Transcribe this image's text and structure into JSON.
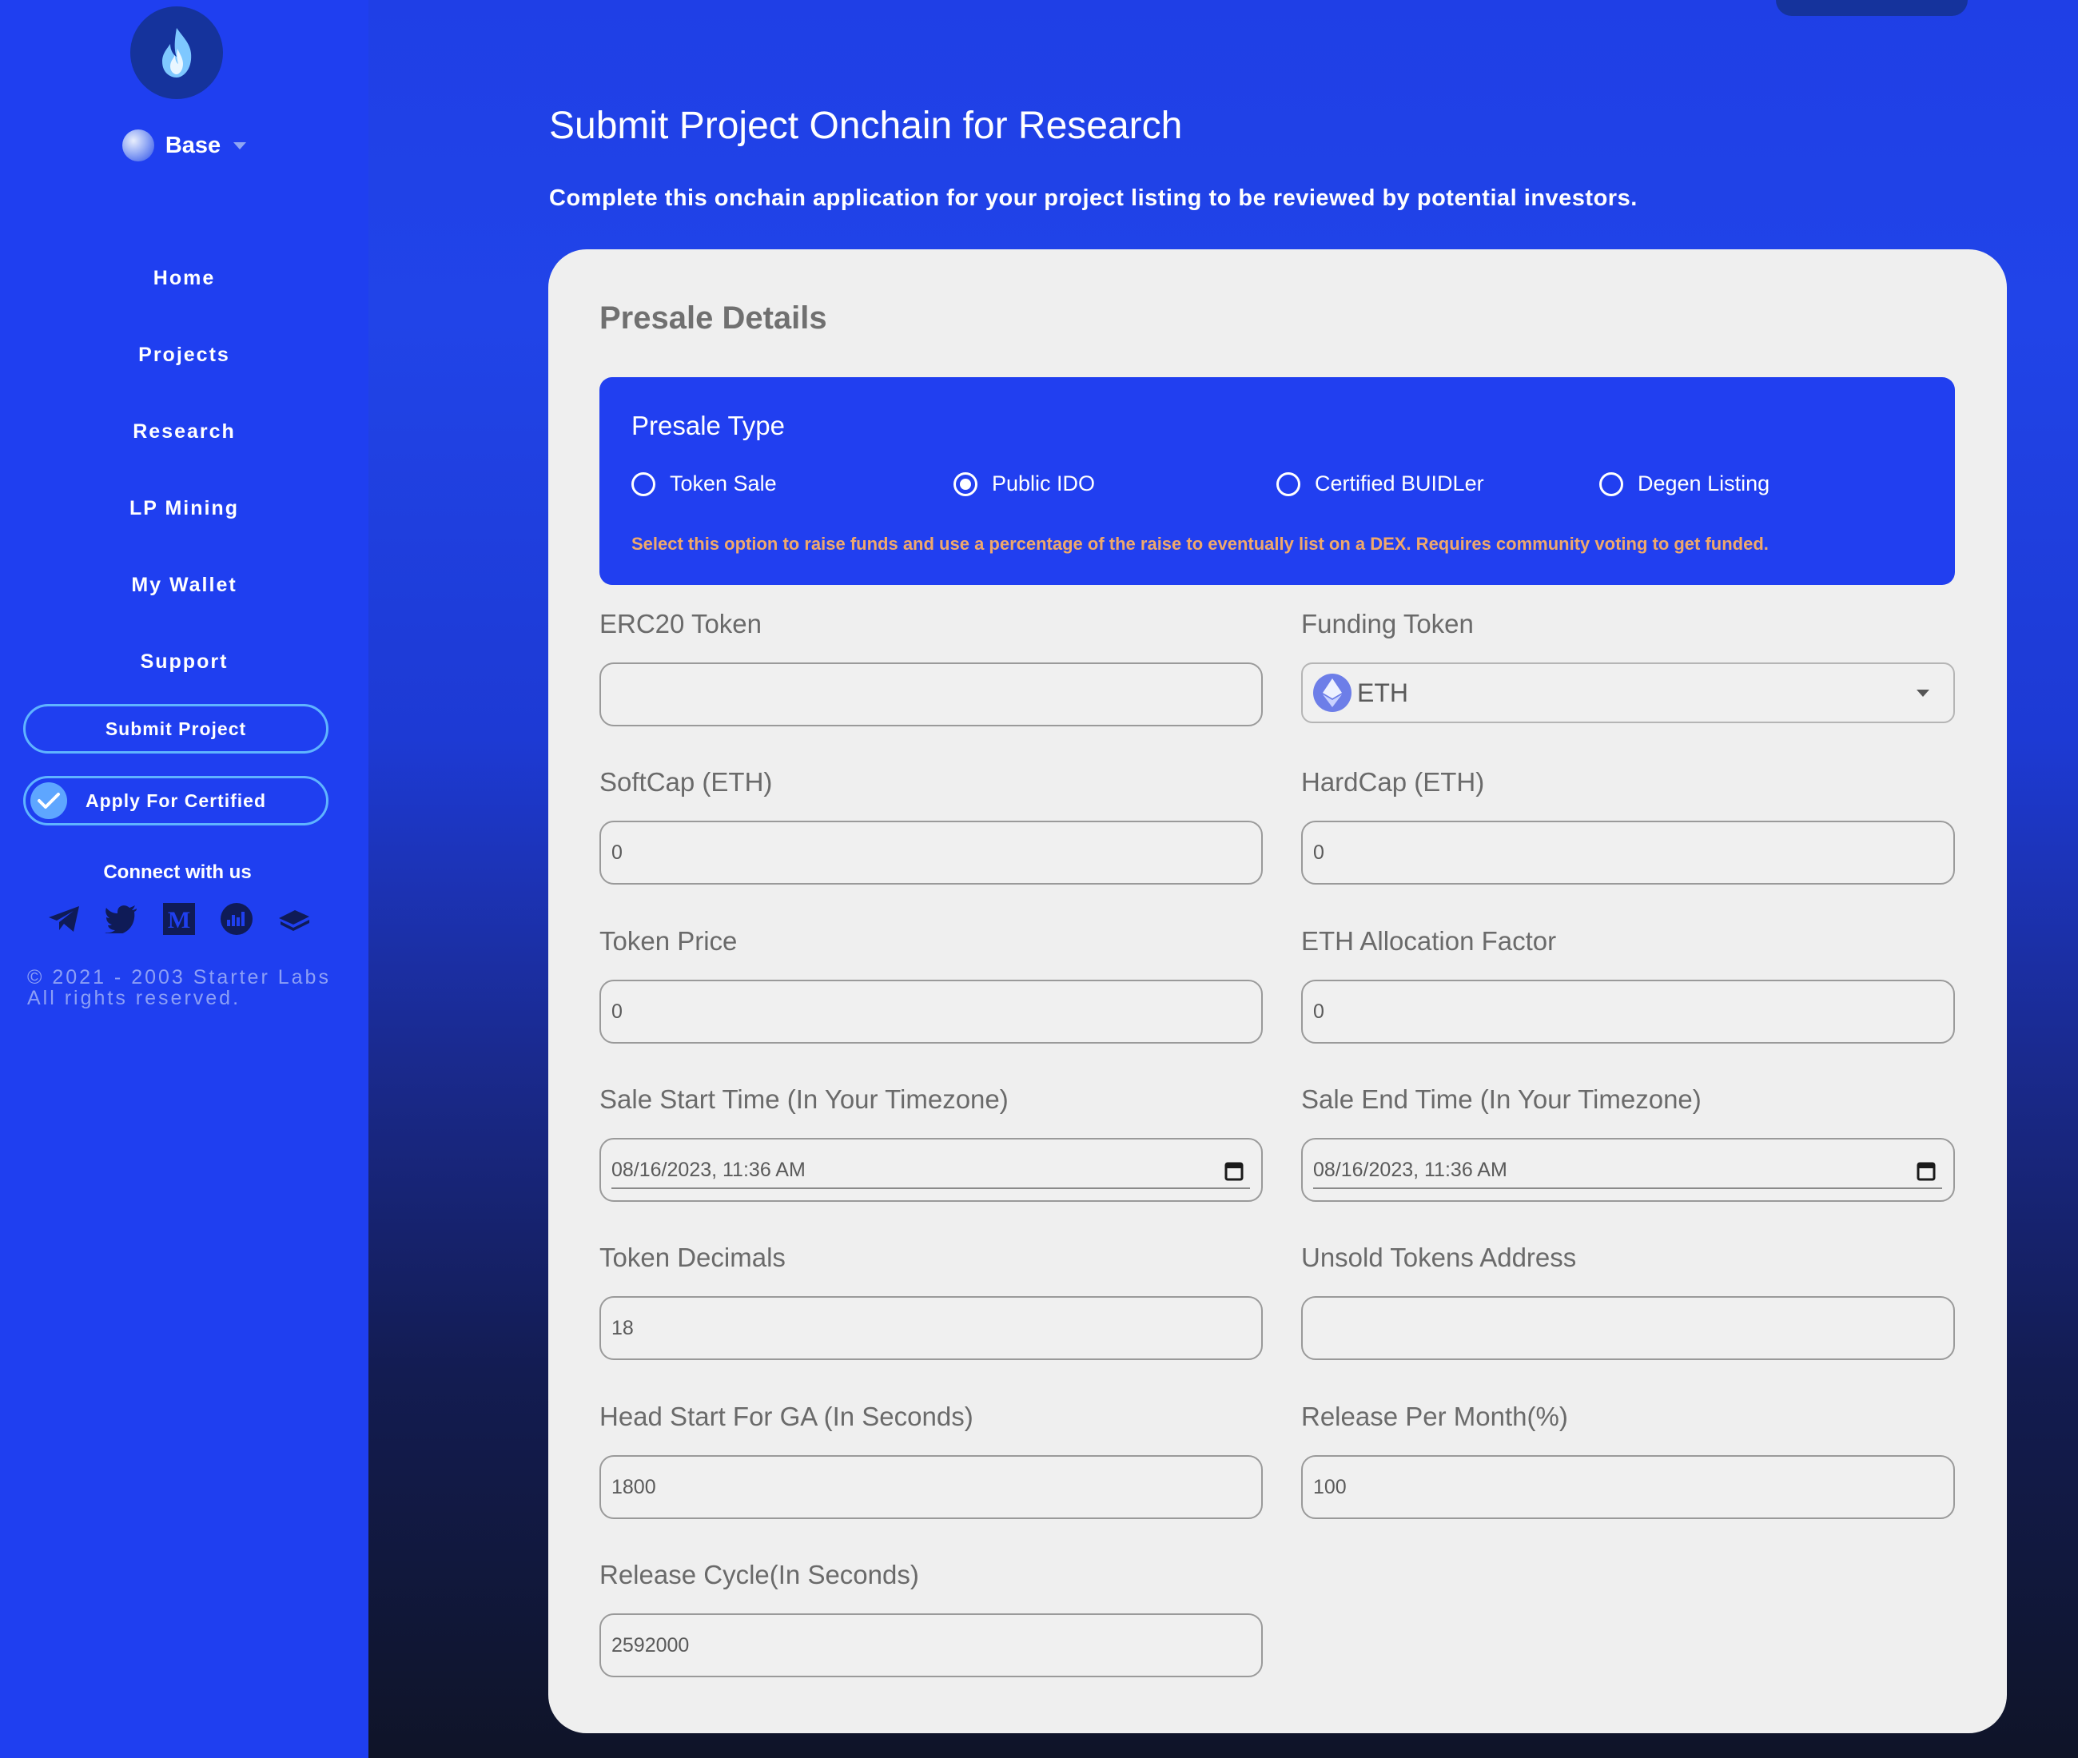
{
  "sidebar": {
    "network": "Base",
    "nav": [
      "Home",
      "Projects",
      "Research",
      "LP Mining",
      "My Wallet",
      "Support"
    ],
    "submit_project": "Submit Project",
    "apply_certified": "Apply For Certified",
    "connect": "Connect with us",
    "socials": [
      "telegram-icon",
      "twitter-icon",
      "medium-icon",
      "coinmarketcap-icon",
      "gitbook-icon"
    ],
    "copyright_line1": "© 2021 - 2003 Starter Labs",
    "copyright_line2": "All rights reserved."
  },
  "page": {
    "title": "Submit Project Onchain for Research",
    "subtitle": "Complete this onchain application for your project listing to be reviewed by potential investors."
  },
  "form": {
    "heading": "Presale Details",
    "presale_type": {
      "label": "Presale Type",
      "options": [
        "Token Sale",
        "Public IDO",
        "Certified BUIDLer",
        "Degen Listing"
      ],
      "selected": "Public IDO",
      "note": "Select this option to raise funds and use a percentage of the raise to eventually list on a DEX. Requires community voting to get funded."
    },
    "erc20_token": {
      "label": "ERC20 Token",
      "value": ""
    },
    "funding_token": {
      "label": "Funding Token",
      "value": "ETH"
    },
    "softcap": {
      "label": "SoftCap (ETH)",
      "value": "0"
    },
    "hardcap": {
      "label": "HardCap (ETH)",
      "value": "0"
    },
    "token_price": {
      "label": "Token Price",
      "value": "0"
    },
    "eth_allocation": {
      "label": "ETH Allocation Factor",
      "value": "0"
    },
    "sale_start": {
      "label": "Sale Start Time (In Your Timezone)",
      "value": "08/16/2023, 11:36 AM"
    },
    "sale_end": {
      "label": "Sale End Time (In Your Timezone)",
      "value": "08/16/2023, 11:36 AM"
    },
    "token_decimals": {
      "label": "Token Decimals",
      "value": "18"
    },
    "unsold_address": {
      "label": "Unsold Tokens Address",
      "value": ""
    },
    "head_start": {
      "label": "Head Start For GA (In Seconds)",
      "value": "1800"
    },
    "release_per_month": {
      "label": "Release Per Month(%)",
      "value": "100"
    },
    "release_cycle": {
      "label": "Release Cycle(In Seconds)",
      "value": "2592000"
    }
  },
  "colors": {
    "sidebar_bg": "#1f3ff0",
    "presale_box_bg": "#213ff0",
    "note_text": "#f0a96b",
    "card_bg": "#efefef"
  }
}
